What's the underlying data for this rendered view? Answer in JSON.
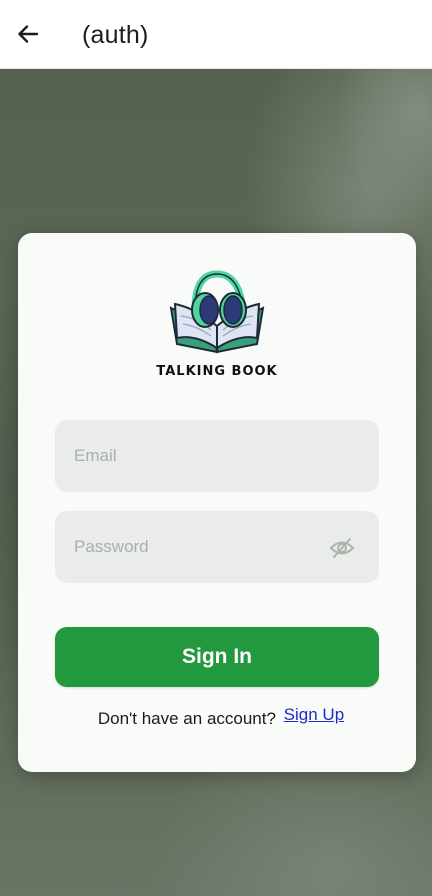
{
  "appbar": {
    "title": "(auth)",
    "back_icon": "arrow-left-icon"
  },
  "logo": {
    "icon": "book-headphones-icon",
    "text": "TALKING BOOK",
    "colors": {
      "headphones": "#4fd6a0",
      "earcups": "#2e3a78",
      "book": "#3aa07a"
    }
  },
  "form": {
    "email": {
      "placeholder": "Email",
      "value": ""
    },
    "password": {
      "placeholder": "Password",
      "value": "",
      "toggle_icon": "eye-slash-icon"
    },
    "sign_in_label": "Sign In"
  },
  "signup": {
    "prompt": "Don't have an account?",
    "link": "Sign Up"
  },
  "colors": {
    "primary": "#22993f",
    "link": "#1f2bc9",
    "card": "#f8fbf8",
    "field": "#e9ece9"
  }
}
